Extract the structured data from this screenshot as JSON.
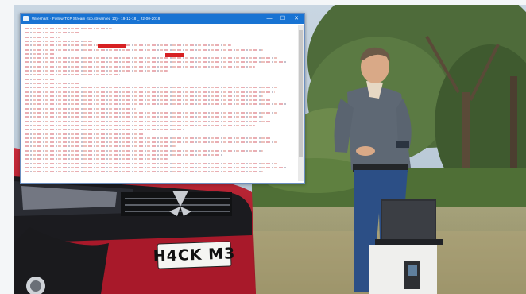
{
  "window": {
    "title": "Wireshark · Follow TCP Stream (tcp.stream eq 10) · 19-12-18 _ 22-00-2018",
    "controls": {
      "minimize": "—",
      "maximize": "☐",
      "close": "✕"
    }
  },
  "scene": {
    "license_plate": "H4CK M3",
    "car_brand_logo": "mitsubishi-logo-icon"
  },
  "colors": {
    "titlebar": "#1873d3",
    "highlight": "#d72022",
    "car": "#b31d2e"
  }
}
